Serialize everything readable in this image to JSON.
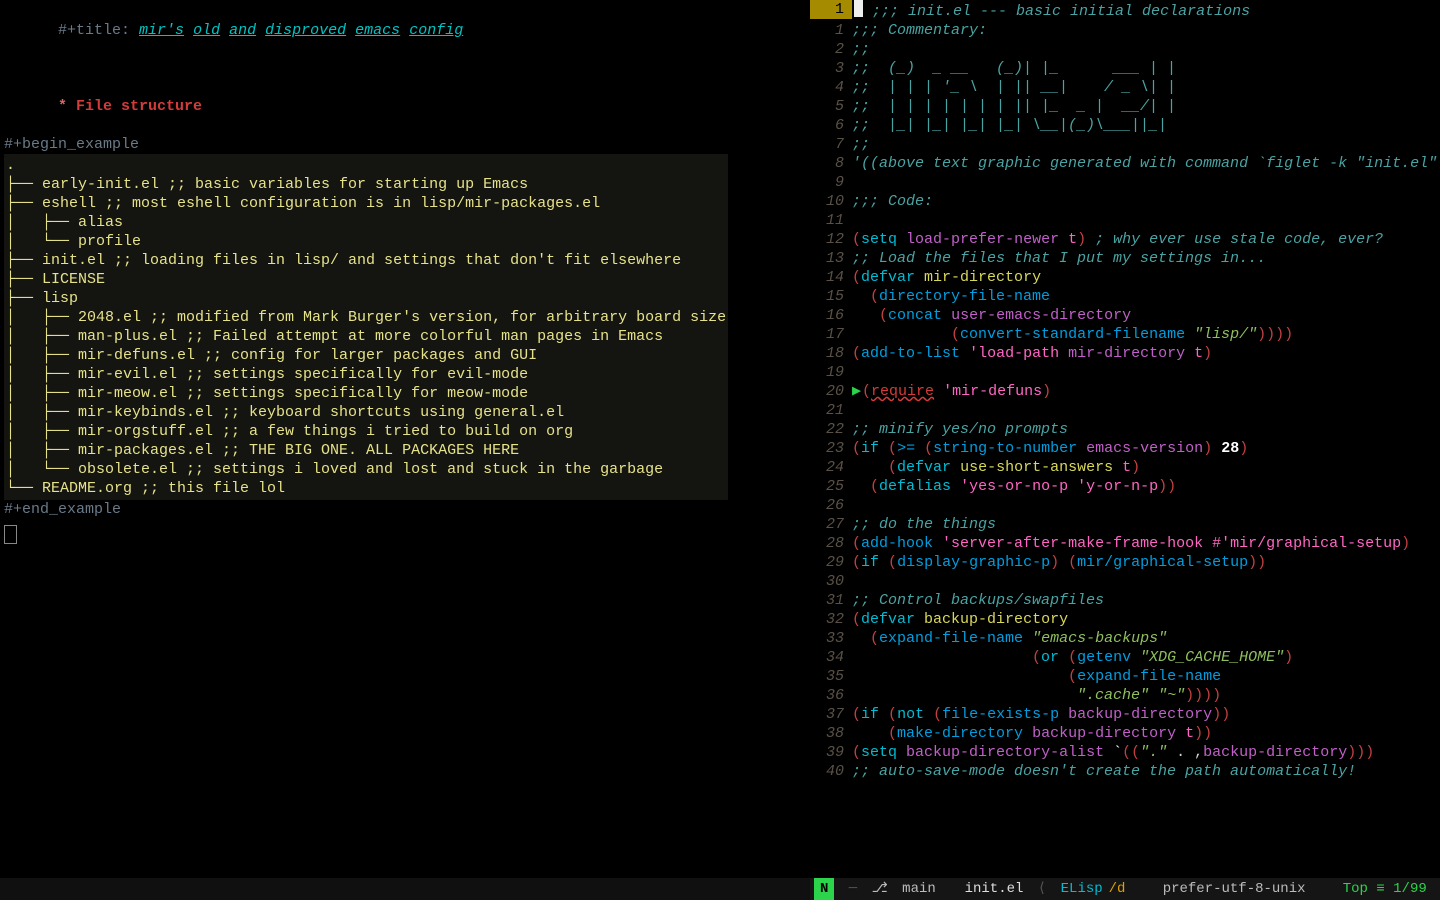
{
  "left": {
    "title_prefix": "#+title: ",
    "title_words": [
      "mir's",
      "old",
      "and",
      "disproved",
      "emacs",
      "config"
    ],
    "heading_star": "* ",
    "heading_text": "File structure",
    "begin_example": "#+begin_example",
    "end_example": "#+end_example",
    "example_lines": [
      ".",
      "├── early-init.el ;; basic variables for starting up Emacs",
      "├── eshell ;; most eshell configuration is in lisp/mir-packages.el",
      "│   ├── alias",
      "│   └── profile",
      "├── init.el ;; loading files in lisp/ and settings that don't fit elsewhere",
      "├── LICENSE",
      "├── lisp",
      "│   ├── 2048.el ;; modified from Mark Burger's version, for arbitrary board size",
      "│   ├── man-plus.el ;; Failed attempt at more colorful man pages in Emacs",
      "│   ├── mir-defuns.el ;; config for larger packages and GUI",
      "│   ├── mir-evil.el ;; settings specifically for evil-mode",
      "│   ├── mir-meow.el ;; settings specifically for meow-mode",
      "│   ├── mir-keybinds.el ;; keyboard shortcuts using general.el",
      "│   ├── mir-orgstuff.el ;; a few things i tried to build on org",
      "│   ├── mir-packages.el ;; THE BIG ONE. ALL PACKAGES HERE",
      "│   └── obsolete.el ;; settings i loved and lost and stuck in the garbage",
      "└── README.org ;; this file lol"
    ]
  },
  "right": {
    "current_line_badge": "1",
    "lines": [
      {
        "n": "",
        "html": "<span class='c-comment'>;;; init.el --- basic initial declarations</span>"
      },
      {
        "n": "1",
        "html": "<span class='c-comment'>;;; Commentary:</span>"
      },
      {
        "n": "2",
        "html": "<span class='c-comment'>;;</span>"
      },
      {
        "n": "3",
        "html": "<span class='c-comment'>;;  (_)  _ __   (_)| |_      ___ | |</span>"
      },
      {
        "n": "4",
        "html": "<span class='c-comment'>;;  | | | '_ \\  | || __|    / _ \\| |</span>"
      },
      {
        "n": "5",
        "html": "<span class='c-comment'>;;  | | | | | | | || |_  _ |  __/| |</span>"
      },
      {
        "n": "6",
        "html": "<span class='c-comment'>;;  |_| |_| |_| |_| \\__|(_)\\___||_|</span>"
      },
      {
        "n": "7",
        "html": "<span class='c-comment'>;;</span>"
      },
      {
        "n": "8",
        "html": "<span class='c-comment'>'((above text graphic generated with command `figlet -k \"init.el\"'))</span>"
      },
      {
        "n": "9",
        "html": ""
      },
      {
        "n": "10",
        "html": "<span class='c-comment'>;;; Code:</span>"
      },
      {
        "n": "11",
        "html": ""
      },
      {
        "n": "12",
        "html": "<span class='c-paren'>(</span><span class='c-kw'>setq</span> <span class='c-var'>load-prefer-newer</span> <span class='c-var2'>t</span><span class='c-paren'>)</span> <span class='c-comment'>; why ever use stale code, ever?</span>"
      },
      {
        "n": "13",
        "html": "<span class='c-comment'>;; Load the files that I put my settings in...</span>"
      },
      {
        "n": "14",
        "html": "<span class='c-paren'>(</span><span class='c-kw'>defvar</span> <span class='c-def'>mir-directory</span>"
      },
      {
        "n": "15",
        "html": "  <span class='c-paren'>(</span><span class='c-fn'>directory-file-name</span>"
      },
      {
        "n": "16",
        "html": "   <span class='c-paren'>(</span><span class='c-fn'>concat</span> <span class='c-var'>user-emacs-directory</span>"
      },
      {
        "n": "17",
        "html": "           <span class='c-paren'>(</span><span class='c-fn'>convert-standard-filename</span> <span class='c-str'>\"lisp/\"</span><span class='c-paren'>))))</span>"
      },
      {
        "n": "18",
        "html": "<span class='c-paren'>(</span><span class='c-fn'>add-to-list</span> <span class='c-var2'>'load-path</span> <span class='c-var'>mir-directory</span> <span class='c-var2'>t</span><span class='c-paren'>)</span>"
      },
      {
        "n": "19",
        "html": ""
      },
      {
        "n": "20",
        "html": "<span class='c-paren'>(</span><span class='c-warn'>require</span> <span class='c-var2'>'mir-defuns</span><span class='c-paren'>)</span>",
        "marker": true
      },
      {
        "n": "21",
        "html": ""
      },
      {
        "n": "22",
        "html": "<span class='c-comment'>;; minify yes/no prompts</span>"
      },
      {
        "n": "23",
        "html": "<span class='c-paren'>(</span><span class='c-kw'>if</span> <span class='c-paren'>(</span><span class='c-fn'>&gt;=</span> <span class='c-paren'>(</span><span class='c-fn'>string-to-number</span> <span class='c-var'>emacs-version</span><span class='c-paren'>)</span> <span class='c-num'>28</span><span class='c-paren'>)</span>"
      },
      {
        "n": "24",
        "html": "    <span class='c-paren'>(</span><span class='c-kw'>defvar</span> <span class='c-def'>use-short-answers</span> <span class='c-var2'>t</span><span class='c-paren'>)</span>"
      },
      {
        "n": "25",
        "html": "  <span class='c-paren'>(</span><span class='c-kw'>defalias</span> <span class='c-var2'>'yes-or-no-p</span> <span class='c-var2'>'y-or-n-p</span><span class='c-paren'>))</span>"
      },
      {
        "n": "26",
        "html": ""
      },
      {
        "n": "27",
        "html": "<span class='c-comment'>;; do the things</span>"
      },
      {
        "n": "28",
        "html": "<span class='c-paren'>(</span><span class='c-fn'>add-hook</span> <span class='c-var2'>'server-after-make-frame-hook</span> <span class='c-var2'>#'mir/graphical-setup</span><span class='c-paren'>)</span>"
      },
      {
        "n": "29",
        "html": "<span class='c-paren'>(</span><span class='c-kw'>if</span> <span class='c-paren'>(</span><span class='c-fn'>display-graphic-p</span><span class='c-paren'>)</span> <span class='c-paren'>(</span><span class='c-fn'>mir/graphical-setup</span><span class='c-paren'>))</span>"
      },
      {
        "n": "30",
        "html": ""
      },
      {
        "n": "31",
        "html": "<span class='c-comment'>;; Control backups/swapfiles</span>"
      },
      {
        "n": "32",
        "html": "<span class='c-paren'>(</span><span class='c-kw'>defvar</span> <span class='c-def'>backup-directory</span>"
      },
      {
        "n": "33",
        "html": "  <span class='c-paren'>(</span><span class='c-fn'>expand-file-name</span> <span class='c-str'>\"emacs-backups\"</span>"
      },
      {
        "n": "34",
        "html": "                    <span class='c-paren'>(</span><span class='c-kw'>or</span> <span class='c-paren'>(</span><span class='c-fn'>getenv</span> <span class='c-str'>\"XDG_CACHE_HOME\"</span><span class='c-paren'>)</span>"
      },
      {
        "n": "35",
        "html": "                        <span class='c-paren'>(</span><span class='c-fn'>expand-file-name</span>"
      },
      {
        "n": "36",
        "html": "                         <span class='c-str'>\".cache\"</span> <span class='c-str'>\"~\"</span><span class='c-paren'>))))</span>"
      },
      {
        "n": "37",
        "html": "<span class='c-paren'>(</span><span class='c-kw'>if</span> <span class='c-paren'>(</span><span class='c-kw'>not</span> <span class='c-paren'>(</span><span class='c-fn'>file-exists-p</span> <span class='c-var'>backup-directory</span><span class='c-paren'>))</span>"
      },
      {
        "n": "38",
        "html": "    <span class='c-paren'>(</span><span class='c-fn'>make-directory</span> <span class='c-var'>backup-directory</span> <span class='c-var2'>t</span><span class='c-paren'>))</span>"
      },
      {
        "n": "39",
        "html": "<span class='c-paren'>(</span><span class='c-kw'>setq</span> <span class='c-var'>backup-directory-alist</span> <span class='c-white'>`</span><span class='c-paren'>((</span><span class='c-str'>\".\"</span> . ,<span class='c-var'>backup-directory</span><span class='c-paren'>)))</span>"
      },
      {
        "n": "40",
        "html": "<span class='c-comment'>;; auto-save-mode doesn't create the path automatically!</span>"
      }
    ]
  },
  "modeline_right": {
    "state": "N",
    "sep1": " ─ ",
    "branch_icon": "⎇",
    "branch": " main",
    "sep2": "  ",
    "buffer": "init.el",
    "sep3": " ⟨ ",
    "mode": "ELisp",
    "mode_mod": "/d",
    "sep4": "   ",
    "encoding": "prefer-utf-8-unix",
    "sep5": "   ",
    "position": "Top ≡ 1/99"
  }
}
